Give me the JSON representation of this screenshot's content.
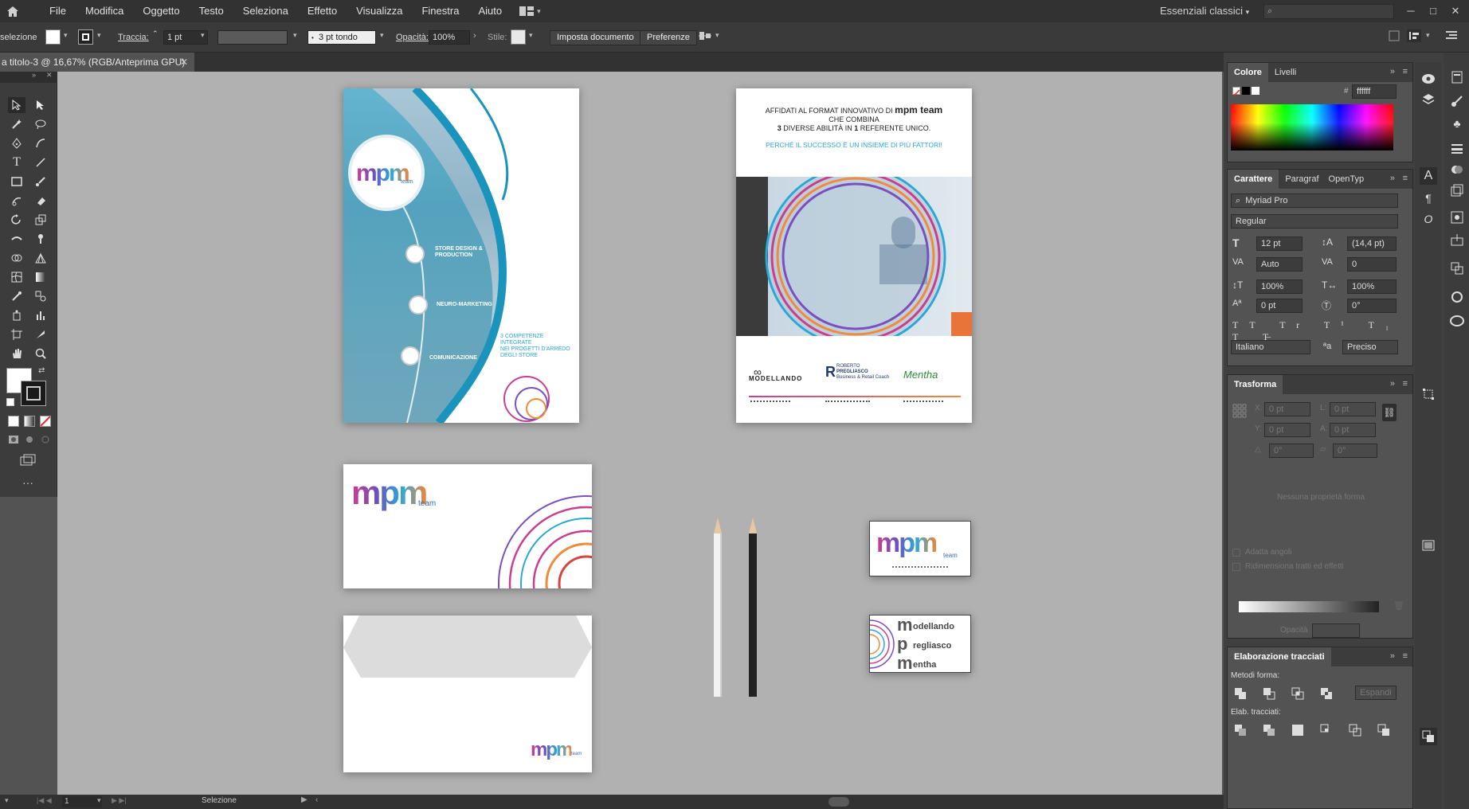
{
  "menubar": {
    "items": [
      "File",
      "Modifica",
      "Oggetto",
      "Testo",
      "Seleziona",
      "Effetto",
      "Visualizza",
      "Finestra",
      "Aiuto"
    ],
    "workspace": "Essenziali classici",
    "search_placeholder": ""
  },
  "control": {
    "selection_label": "selezione",
    "stroke_label": "Traccia:",
    "stroke_weight": "1 pt",
    "brush": "3 pt tondo",
    "opacity_label": "Opacità:",
    "opacity": "100%",
    "style_label": "Stile:",
    "doc_setup": "Imposta documento",
    "prefs": "Preferenze"
  },
  "document": {
    "tab_title": "a titolo-3 @ 16,67% (RGB/Anteprima GPU)"
  },
  "panels": {
    "color": {
      "tabs": [
        "Colore",
        "Livelli"
      ],
      "hex": "ffffff"
    },
    "character": {
      "tabs": [
        "Carattere",
        "Paragraf",
        "OpenTyp"
      ],
      "font": "Myriad Pro",
      "style": "Regular",
      "size": "12 pt",
      "leading": "(14,4 pt)",
      "kerning": "Auto",
      "tracking": "0",
      "vscale": "100%",
      "hscale": "100%",
      "baseline": "0 pt",
      "rotation": "0°",
      "language": "Italiano",
      "aa": "Preciso"
    },
    "transform": {
      "title": "Trasforma",
      "x": "0 pt",
      "y": "0 pt",
      "l": "0 pt",
      "a": "0 pt",
      "angle1": "0°",
      "angle2": "0°",
      "no_props": "Nessuna proprietà forma",
      "chk1": "Adatta angoli",
      "chk2": "Ridimensiona tratti ed effetti",
      "opacity_label": "Opacità"
    },
    "pathfinder": {
      "title": "Elaborazione tracciati",
      "shape_modes": "Metodi forma:",
      "expand": "Espandi",
      "pathfinders": "Elab. tracciati:"
    }
  },
  "status": {
    "zoom": "1",
    "mode": "Selezione"
  },
  "artwork": {
    "brochure_cover": {
      "logo_main": "mpm",
      "logo_sub": "team",
      "services": [
        "STORE DESIGN &",
        "PRODUCTION",
        "NEURO-MARKETING",
        "COMUNICAZIONE"
      ],
      "tagline": [
        "3 COMPETENZE",
        "INTEGRATE",
        "NEI PROGETTI D'ARREDO",
        "DEGLI STORE"
      ]
    },
    "brochure_back": {
      "line1_pre": "AFFIDATI AL FORMAT INNOVATIVO DI ",
      "line1_brand": "mpm team",
      "line2": "CHE COMBINA",
      "line3_n": "3",
      "line3a": " DIVERSE ABILITÀ IN ",
      "line3_n2": "1",
      "line3b": " REFERENTE UNICO.",
      "line4": "PERCHÉ IL SUCCESSO È UN INSIEME DI PIÙ FATTORI!",
      "brands": [
        "MODELLANDO",
        "ROBERTO",
        "PREGLIASCO",
        "Business & Retail Coach",
        "Mentha"
      ]
    },
    "letterhead": {
      "logo_main": "mpm",
      "logo_sub": "team"
    },
    "envelope": {
      "logo_main": "mpm",
      "logo_sub": "team"
    },
    "card_front": {
      "logo_main": "mpm",
      "logo_sub": "team"
    },
    "card_back": {
      "names": [
        "odellando",
        "regliasco",
        "entha"
      ],
      "letter": [
        "m",
        "p",
        "m"
      ]
    }
  }
}
